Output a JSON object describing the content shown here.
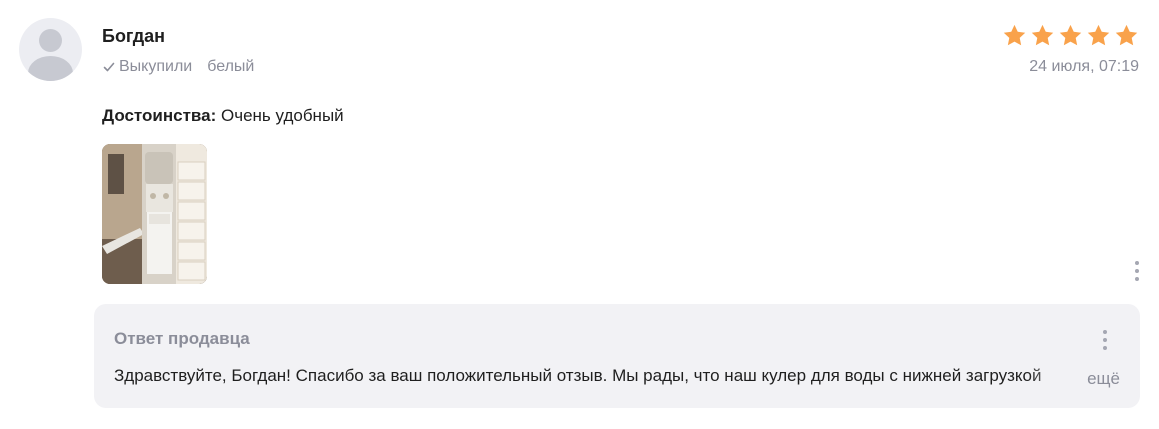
{
  "review": {
    "author": "Богдан",
    "purchased_label": "Выкупили",
    "variant": "белый",
    "rating": 5,
    "rating_max": 5,
    "star_color": "#f9a24b",
    "date": "24 июля, 07:19",
    "pros_label": "Достоинства:",
    "pros_text": "Очень удобный",
    "photos_count": 1
  },
  "seller_reply": {
    "title": "Ответ продавца",
    "text": "Здравствуйте, Богдан! Спасибо за ваш положительный отзыв. Мы рады, что наш кулер для воды с нижней загрузкой",
    "expand_label": "ещё"
  },
  "colors": {
    "secondary_text": "#8b8d99",
    "reply_background": "#f2f2f5",
    "avatar_background": "#ecedf2"
  }
}
